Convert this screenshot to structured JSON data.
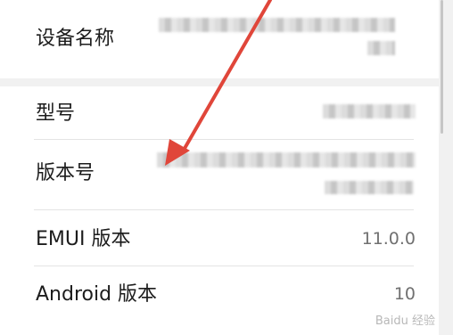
{
  "settings": {
    "rows": [
      {
        "label": "设备名称",
        "value": ""
      },
      {
        "label": "型号",
        "value": ""
      },
      {
        "label": "版本号",
        "value": ""
      },
      {
        "label": "EMUI 版本",
        "value": "11.0.0"
      },
      {
        "label": "Android 版本",
        "value": "10"
      }
    ]
  },
  "annotation": {
    "color": "#e0463a"
  },
  "watermark": {
    "text": "Baidu 经验"
  }
}
